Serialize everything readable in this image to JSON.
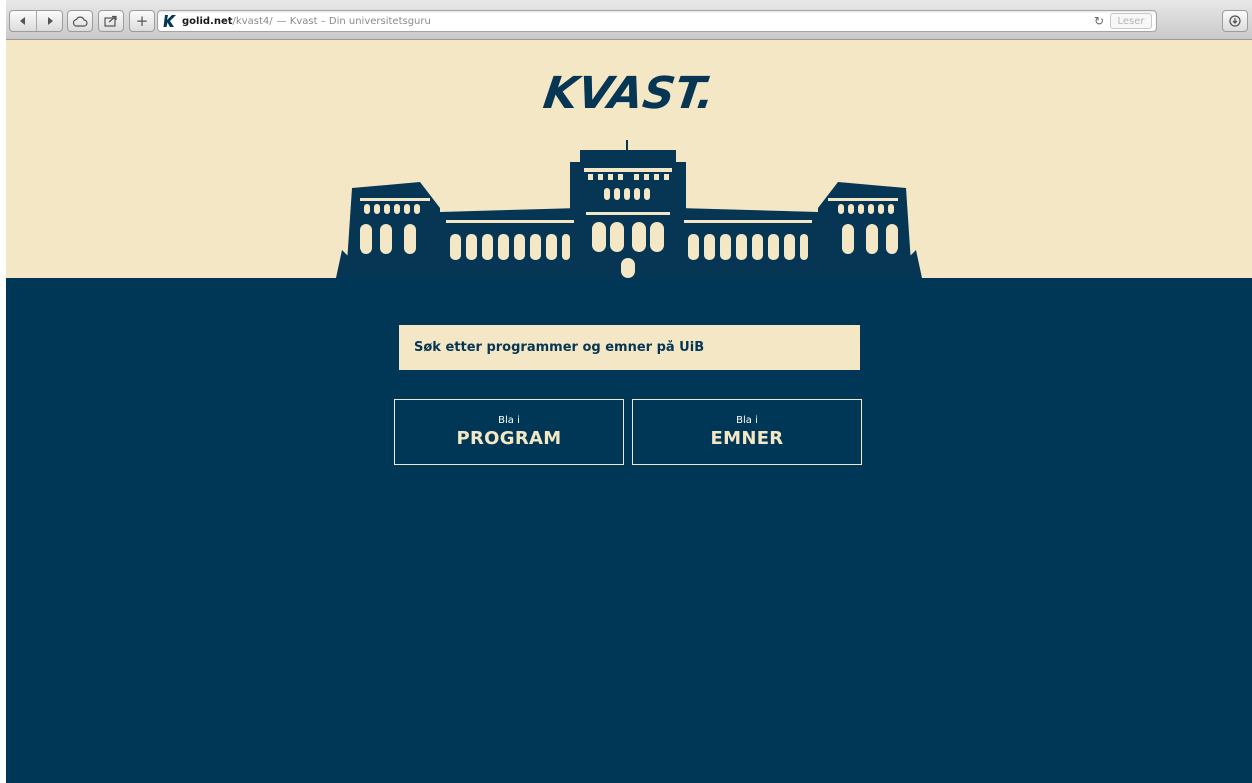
{
  "browser": {
    "url_host": "golid.net",
    "url_path": "/kvast4/",
    "page_title": "— Kvast – Din universitetsguru",
    "reader_label": "Leser",
    "icons": [
      "back-icon",
      "forward-icon",
      "cloud-icon",
      "share-icon",
      "plus-icon",
      "reload-icon",
      "download-icon"
    ]
  },
  "hero": {
    "logo": "KVAST.",
    "background_color": "#f3e7c6",
    "illustration": "university-building-icon"
  },
  "main": {
    "background_color": "#013756",
    "search": {
      "placeholder": "Søk etter programmer og emner på UiB"
    },
    "browse_buttons": [
      {
        "small": "Bla i",
        "big": "PROGRAM"
      },
      {
        "small": "Bla i",
        "big": "EMNER"
      }
    ]
  }
}
